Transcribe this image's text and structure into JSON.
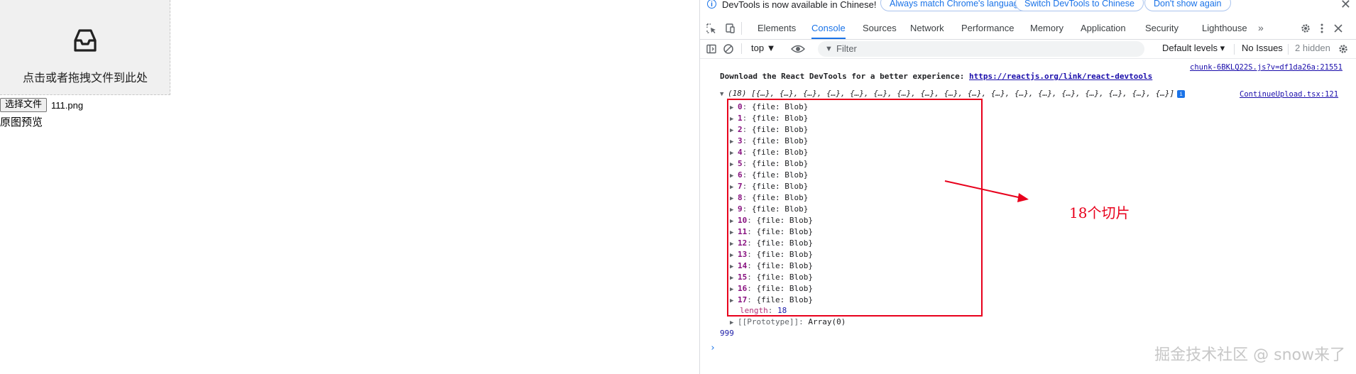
{
  "upload": {
    "hint": "点击或者拖拽文件到此处",
    "choose_button": "选择文件",
    "file_name": "111.png",
    "preview_label": "原图预览"
  },
  "infobar": {
    "message": "DevTools is now available in Chinese!",
    "match_language": "Always match Chrome's language",
    "switch_chinese": "Switch DevTools to Chinese",
    "dont_show": "Don't show again",
    "close": "✕"
  },
  "tabs": [
    "Elements",
    "Console",
    "Sources",
    "Network",
    "Performance",
    "Memory",
    "Application",
    "Security",
    "Lighthouse"
  ],
  "active_tab": "Console",
  "toolbar": {
    "context": "top ▼",
    "filter_placeholder": "Filter",
    "default_levels": "Default levels ▾",
    "no_issues": "No Issues",
    "hidden": "2 hidden"
  },
  "console": {
    "react_source": "chunk-6BKLQ22S.js?v=df1da26a:21551",
    "react_message": "Download the React DevTools for a better experience:",
    "react_link": "https://reactjs.org/link/react-devtools",
    "array_summary": "(18) [{…}, {…}, {…}, {…}, {…}, {…}, {…}, {…}, {…}, {…}, {…}, {…}, {…}, {…}, {…}, {…}, {…}, {…}]",
    "array_source": "ContinueUpload.tsx:121",
    "entries": [
      {
        "index": "0"
      },
      {
        "index": "1"
      },
      {
        "index": "2"
      },
      {
        "index": "3"
      },
      {
        "index": "4"
      },
      {
        "index": "5"
      },
      {
        "index": "6"
      },
      {
        "index": "7"
      },
      {
        "index": "8"
      },
      {
        "index": "9"
      },
      {
        "index": "10"
      },
      {
        "index": "11"
      },
      {
        "index": "12"
      },
      {
        "index": "13"
      },
      {
        "index": "14"
      },
      {
        "index": "15"
      },
      {
        "index": "16"
      },
      {
        "index": "17"
      }
    ],
    "entry_value": "{file: Blob}",
    "length_key": "length",
    "length_value": "18",
    "prototype_key": "[[Prototype]]",
    "prototype_value": "Array(0)",
    "log_value": "999",
    "prompt": "›"
  },
  "annotation": {
    "label": "18个切片",
    "color": "#e8001c"
  },
  "watermark": "掘金技术社区 @ snow来了"
}
